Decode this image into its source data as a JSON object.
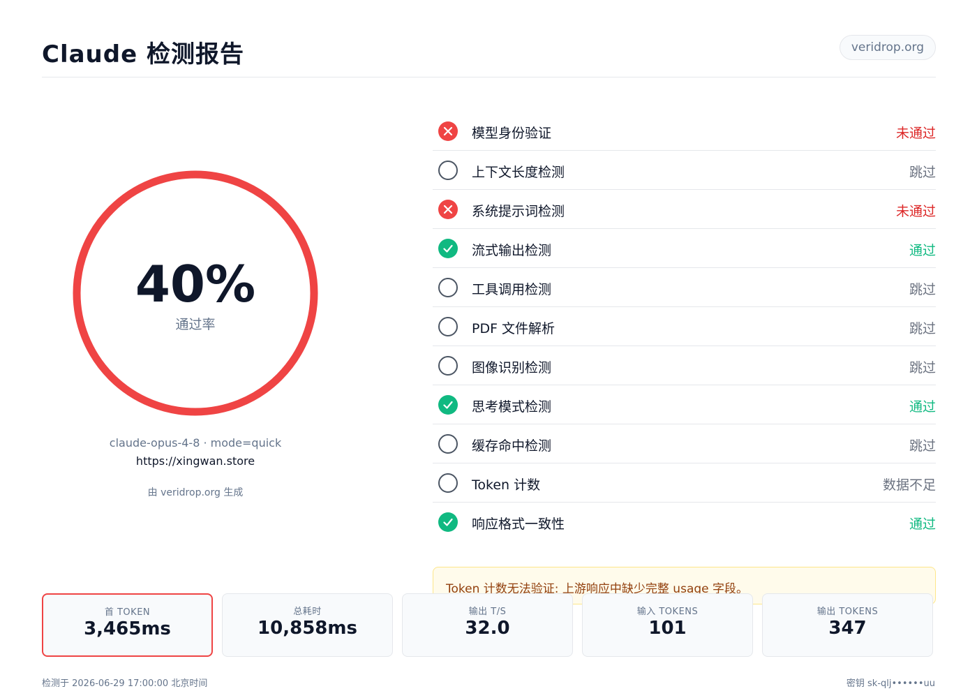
{
  "header": {
    "title": "Claude 检测报告",
    "domain_badge": "veridrop.org"
  },
  "score": {
    "value": "40%",
    "label": "通过率",
    "progress_fraction": 0.4,
    "ring_color": "#ef4444"
  },
  "meta": {
    "model_line": "claude-opus-4-8  ·  mode=quick",
    "url": "https://xingwan.store",
    "powered_by": "由 veridrop.org 生成"
  },
  "checks": [
    {
      "name": "模型身份验证",
      "result": "未通过",
      "status": "fail",
      "icon": "x-circle-icon"
    },
    {
      "name": "上下文长度检测",
      "result": "跳过",
      "status": "skip",
      "icon": "empty-circle-icon"
    },
    {
      "name": "系统提示词检测",
      "result": "未通过",
      "status": "fail",
      "icon": "x-circle-icon"
    },
    {
      "name": "流式输出检测",
      "result": "通过",
      "status": "pass",
      "icon": "check-circle-icon"
    },
    {
      "name": "工具调用检测",
      "result": "跳过",
      "status": "skip",
      "icon": "empty-circle-icon"
    },
    {
      "name": "PDF 文件解析",
      "result": "跳过",
      "status": "skip",
      "icon": "empty-circle-icon"
    },
    {
      "name": "图像识别检测",
      "result": "跳过",
      "status": "skip",
      "icon": "empty-circle-icon"
    },
    {
      "name": "思考模式检测",
      "result": "通过",
      "status": "pass",
      "icon": "check-circle-icon"
    },
    {
      "name": "缓存命中检测",
      "result": "跳过",
      "status": "skip",
      "icon": "empty-circle-icon"
    },
    {
      "name": "Token 计数",
      "result": "数据不足",
      "status": "skip",
      "icon": "empty-circle-icon"
    },
    {
      "name": "响应格式一致性",
      "result": "通过",
      "status": "pass",
      "icon": "check-circle-icon"
    }
  ],
  "warning": "Token 计数无法验证: 上游响应中缺少完整 usage 字段。",
  "stats": [
    {
      "label": "首 TOKEN",
      "value": "3,465ms",
      "highlight": true
    },
    {
      "label": "总耗时",
      "value": "10,858ms",
      "highlight": false
    },
    {
      "label": "输出 T/S",
      "value": "32.0",
      "highlight": false
    },
    {
      "label": "输入 TOKENS",
      "value": "101",
      "highlight": false
    },
    {
      "label": "输出 TOKENS",
      "value": "347",
      "highlight": false
    }
  ],
  "footer": {
    "left": "检测于 2026-06-29 17:00:00 北京时间",
    "right": "密钥 sk-qlj••••••uu"
  }
}
